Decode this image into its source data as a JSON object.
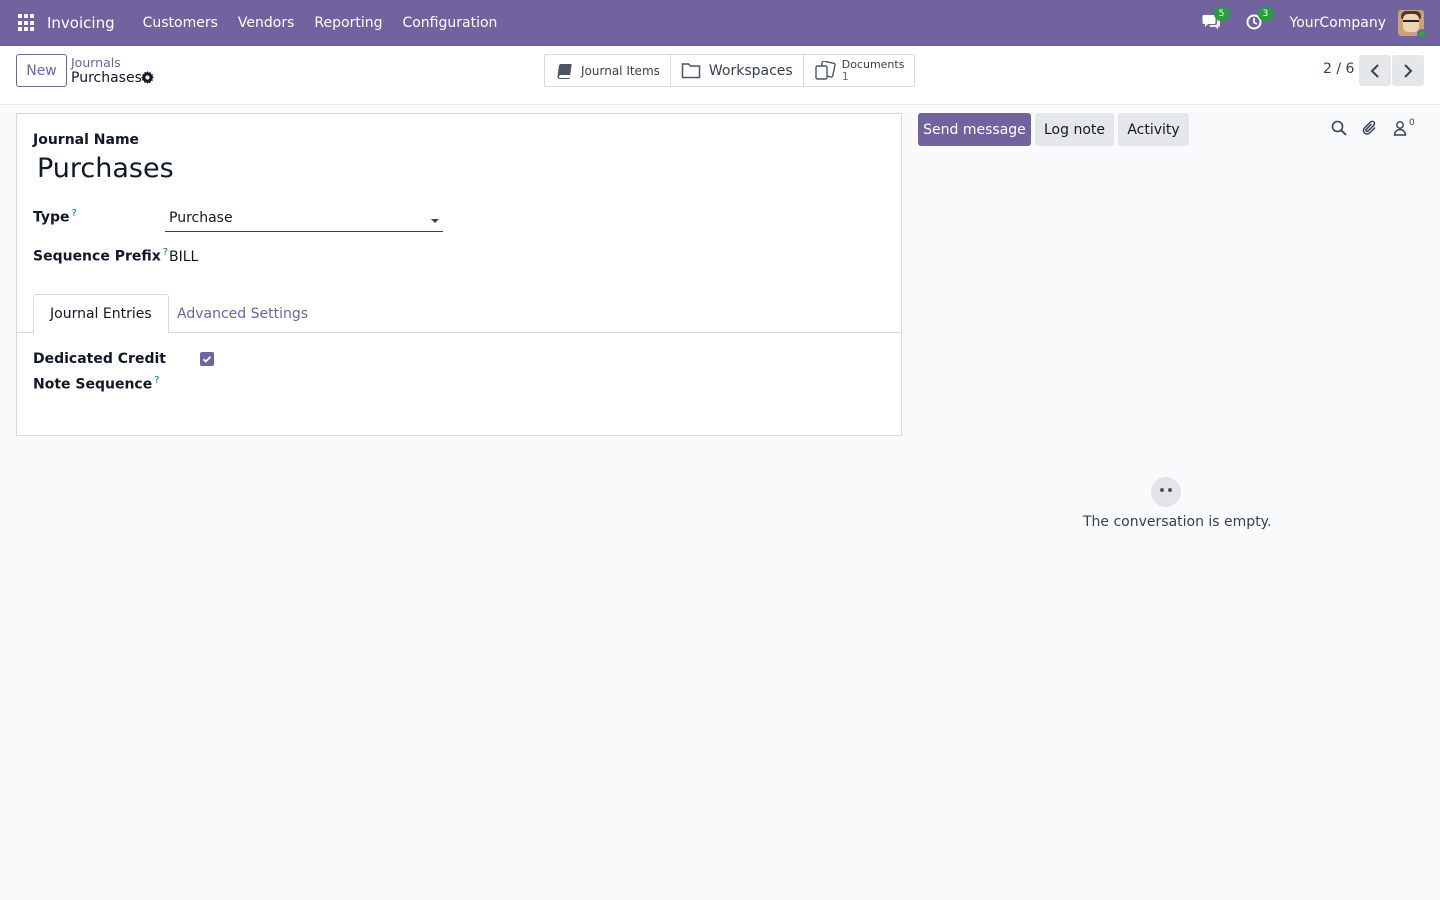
{
  "navbar": {
    "brand": "Invoicing",
    "menu": [
      "Customers",
      "Vendors",
      "Reporting",
      "Configuration"
    ],
    "messages_count": "5",
    "activities_count": "3",
    "company": "YourCompany"
  },
  "control": {
    "new_label": "New",
    "breadcrumb_parent": "Journals",
    "breadcrumb_current": "Purchases",
    "smart_buttons": {
      "journal_items": "Journal Items",
      "workspaces": "Workspaces",
      "documents": "Documents",
      "documents_count": "1"
    },
    "pager": "2 / 6"
  },
  "form": {
    "journal_name_label": "Journal Name",
    "journal_name": "Purchases",
    "type_label": "Type",
    "type_value": "Purchase",
    "sequence_prefix_label": "Sequence Prefix",
    "sequence_prefix_value": "BILL",
    "help_mark": "?",
    "tabs": [
      "Journal Entries",
      "Advanced Settings"
    ],
    "credit_note_label": "Dedicated Credit Note Sequence",
    "credit_note_checked": true
  },
  "chatter": {
    "send_message": "Send message",
    "log_note": "Log note",
    "activity": "Activity",
    "followers_count": "0",
    "empty_text": "The conversation is empty."
  },
  "colors": {
    "brand": "#71639e",
    "badge": "#2a9d3f",
    "help": "#017e84"
  }
}
